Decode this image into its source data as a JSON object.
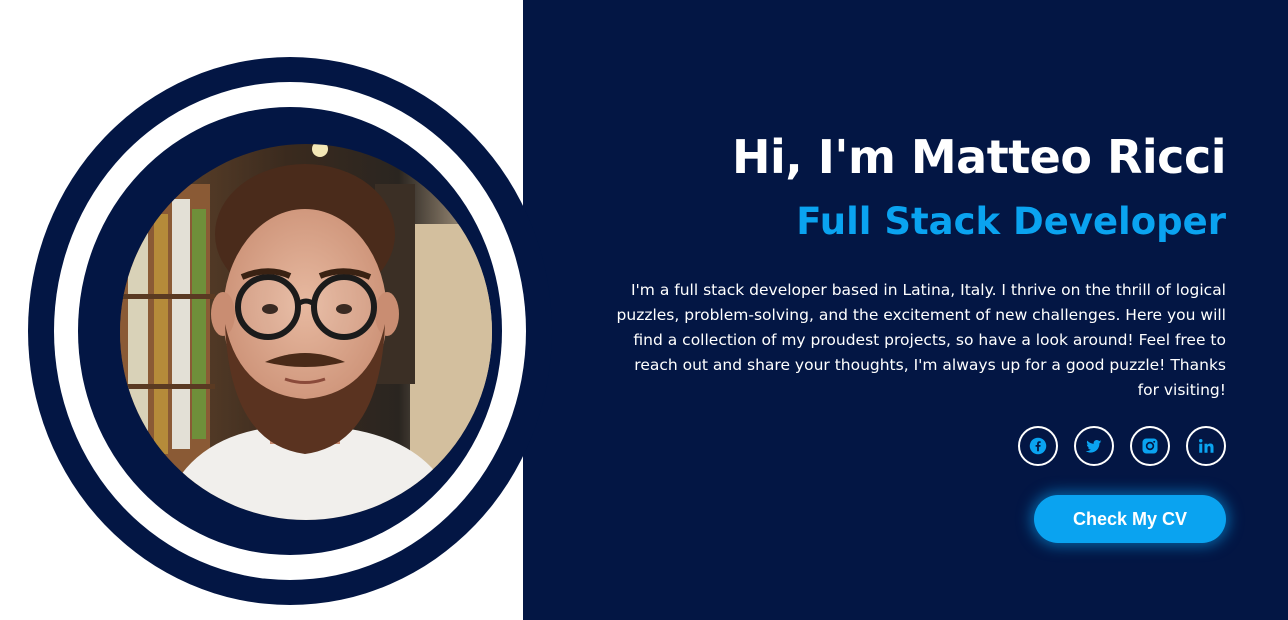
{
  "hero": {
    "headline": "Hi, I'm Matteo Ricci",
    "role": "Full Stack Developer",
    "bio": "I'm a full stack developer based in Latina, Italy. I thrive on the thrill of logical puzzles, problem-solving, and the excitement of new challenges. Here you will find a collection of my proudest projects, so have a look around! Feel free to reach out and share your thoughts, I'm always up for a good puzzle! Thanks for visiting!",
    "cv_button_label": "Check My CV"
  },
  "socials": [
    {
      "icon": "facebook-icon"
    },
    {
      "icon": "twitter-icon"
    },
    {
      "icon": "instagram-icon"
    },
    {
      "icon": "linkedin-icon"
    }
  ],
  "colors": {
    "navy": "#031644",
    "accent": "#0aa3f0",
    "white": "#ffffff"
  }
}
